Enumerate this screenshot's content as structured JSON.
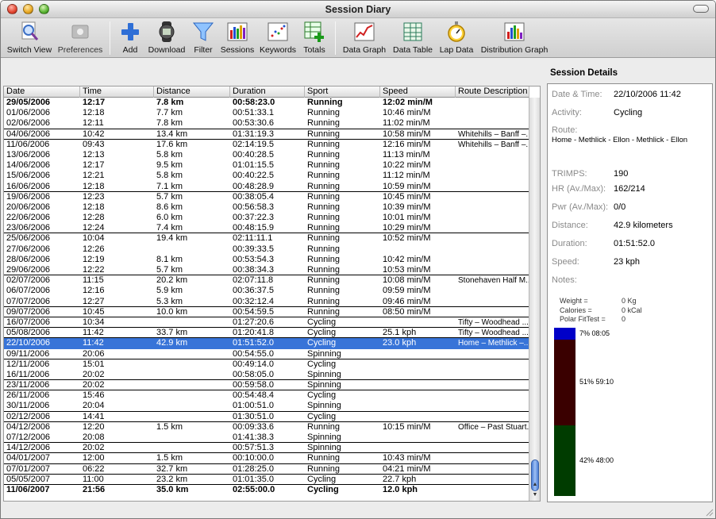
{
  "window": {
    "title": "Session Diary"
  },
  "toolbar": {
    "switch_view": "Switch View",
    "preferences": "Preferences",
    "add": "Add",
    "download": "Download",
    "filter": "Filter",
    "sessions": "Sessions",
    "keywords": "Keywords",
    "totals": "Totals",
    "data_graph": "Data Graph",
    "data_table": "Data Table",
    "lap_data": "Lap Data",
    "distribution_graph": "Distribution Graph"
  },
  "table": {
    "columns": [
      "Date",
      "Time",
      "Distance",
      "Duration",
      "Sport",
      "Speed",
      "Route Description"
    ],
    "rows": [
      {
        "date": "29/05/2006",
        "time": "12:17",
        "distance": "7.8 km",
        "duration": "00:58:23.0",
        "sport": "Running",
        "speed": "12:02 min/M",
        "route": "",
        "bold": true,
        "line": false
      },
      {
        "date": "01/06/2006",
        "time": "12:18",
        "distance": "7.7 km",
        "duration": "00:51:33.1",
        "sport": "Running",
        "speed": "10:46 min/M",
        "route": "",
        "line": false
      },
      {
        "date": "02/06/2006",
        "time": "12:11",
        "distance": "7.8 km",
        "duration": "00:53:30.6",
        "sport": "Running",
        "speed": "11:02 min/M",
        "route": "",
        "line": true
      },
      {
        "date": "04/06/2006",
        "time": "10:42",
        "distance": "13.4 km",
        "duration": "01:31:19.3",
        "sport": "Running",
        "speed": "10:58 min/M",
        "route": "Whitehills – Banff –...",
        "line": true
      },
      {
        "date": "11/06/2006",
        "time": "09:43",
        "distance": "17.6 km",
        "duration": "02:14:19.5",
        "sport": "Running",
        "speed": "12:16 min/M",
        "route": "Whitehills – Banff –...",
        "line": false
      },
      {
        "date": "13/06/2006",
        "time": "12:13",
        "distance": "5.8 km",
        "duration": "00:40:28.5",
        "sport": "Running",
        "speed": "11:13 min/M",
        "route": "",
        "line": false
      },
      {
        "date": "14/06/2006",
        "time": "12:17",
        "distance": "9.5 km",
        "duration": "01:01:15.5",
        "sport": "Running",
        "speed": "10:22 min/M",
        "route": "",
        "line": false
      },
      {
        "date": "15/06/2006",
        "time": "12:21",
        "distance": "5.8 km",
        "duration": "00:40:22.5",
        "sport": "Running",
        "speed": "11:12 min/M",
        "route": "",
        "line": false
      },
      {
        "date": "16/06/2006",
        "time": "12:18",
        "distance": "7.1 km",
        "duration": "00:48:28.9",
        "sport": "Running",
        "speed": "10:59 min/M",
        "route": "",
        "line": true
      },
      {
        "date": "19/06/2006",
        "time": "12:23",
        "distance": "5.7 km",
        "duration": "00:38:05.4",
        "sport": "Running",
        "speed": "10:45 min/M",
        "route": "",
        "line": false
      },
      {
        "date": "20/06/2006",
        "time": "12:18",
        "distance": "8.6 km",
        "duration": "00:56:58.3",
        "sport": "Running",
        "speed": "10:39 min/M",
        "route": "",
        "line": false
      },
      {
        "date": "22/06/2006",
        "time": "12:28",
        "distance": "6.0 km",
        "duration": "00:37:22.3",
        "sport": "Running",
        "speed": "10:01 min/M",
        "route": "",
        "line": false
      },
      {
        "date": "23/06/2006",
        "time": "12:24",
        "distance": "7.4 km",
        "duration": "00:48:15.9",
        "sport": "Running",
        "speed": "10:29 min/M",
        "route": "",
        "line": true
      },
      {
        "date": "25/06/2006",
        "time": "10:04",
        "distance": "19.4 km",
        "duration": "02:11:11.1",
        "sport": "Running",
        "speed": "10:52 min/M",
        "route": "",
        "line": false
      },
      {
        "date": "27/06/2006",
        "time": "12:26",
        "distance": "",
        "duration": "00:39:33.5",
        "sport": "Running",
        "speed": "",
        "route": "",
        "line": false
      },
      {
        "date": "28/06/2006",
        "time": "12:19",
        "distance": "8.1 km",
        "duration": "00:53:54.3",
        "sport": "Running",
        "speed": "10:42 min/M",
        "route": "",
        "line": false
      },
      {
        "date": "29/06/2006",
        "time": "12:22",
        "distance": "5.7 km",
        "duration": "00:38:34.3",
        "sport": "Running",
        "speed": "10:53 min/M",
        "route": "",
        "line": true
      },
      {
        "date": "02/07/2006",
        "time": "11:15",
        "distance": "20.2 km",
        "duration": "02:07:11.8",
        "sport": "Running",
        "speed": "10:08 min/M",
        "route": "Stonehaven Half M...",
        "line": false
      },
      {
        "date": "06/07/2006",
        "time": "12:16",
        "distance": "5.9 km",
        "duration": "00:36:37.5",
        "sport": "Running",
        "speed": "09:59 min/M",
        "route": "",
        "line": false
      },
      {
        "date": "07/07/2006",
        "time": "12:27",
        "distance": "5.3 km",
        "duration": "00:32:12.4",
        "sport": "Running",
        "speed": "09:46 min/M",
        "route": "",
        "line": true
      },
      {
        "date": "09/07/2006",
        "time": "10:45",
        "distance": "10.0 km",
        "duration": "00:54:59.5",
        "sport": "Running",
        "speed": "08:50 min/M",
        "route": "",
        "line": true
      },
      {
        "date": "16/07/2006",
        "time": "10:34",
        "distance": "",
        "duration": "01:27:20.6",
        "sport": "Cycling",
        "speed": "",
        "route": "Tifty – Woodhead ...",
        "line": true
      },
      {
        "date": "05/08/2006",
        "time": "11:42",
        "distance": "33.7 km",
        "duration": "01:20:41.8",
        "sport": "Cycling",
        "speed": "25.1 kph",
        "route": "Tifty – Woodhead ...",
        "line": true
      },
      {
        "date": "22/10/2006",
        "time": "11:42",
        "distance": "42.9 km",
        "duration": "01:51:52.0",
        "sport": "Cycling",
        "speed": "23.0 kph",
        "route": "Home – Methlick –...",
        "selected": true,
        "line": false
      },
      {
        "date": "09/11/2006",
        "time": "20:06",
        "distance": "",
        "duration": "00:54:55.0",
        "sport": "Spinning",
        "speed": "",
        "route": "",
        "line": true
      },
      {
        "date": "12/11/2006",
        "time": "15:01",
        "distance": "",
        "duration": "00:49:14.0",
        "sport": "Cycling",
        "speed": "",
        "route": "",
        "line": false
      },
      {
        "date": "16/11/2006",
        "time": "20:02",
        "distance": "",
        "duration": "00:58:05.0",
        "sport": "Spinning",
        "speed": "",
        "route": "",
        "line": true
      },
      {
        "date": "23/11/2006",
        "time": "20:02",
        "distance": "",
        "duration": "00:59:58.0",
        "sport": "Spinning",
        "speed": "",
        "route": "",
        "line": true
      },
      {
        "date": "26/11/2006",
        "time": "15:46",
        "distance": "",
        "duration": "00:54:48.4",
        "sport": "Cycling",
        "speed": "",
        "route": "",
        "line": false
      },
      {
        "date": "30/11/2006",
        "time": "20:04",
        "distance": "",
        "duration": "01:00:51.0",
        "sport": "Spinning",
        "speed": "",
        "route": "",
        "line": true
      },
      {
        "date": "02/12/2006",
        "time": "14:41",
        "distance": "",
        "duration": "01:30:51.0",
        "sport": "Cycling",
        "speed": "",
        "route": "",
        "line": true
      },
      {
        "date": "04/12/2006",
        "time": "12:20",
        "distance": "1.5 km",
        "duration": "00:09:33.6",
        "sport": "Running",
        "speed": "10:15 min/M",
        "route": "Office – Past Stuart...",
        "line": false
      },
      {
        "date": "07/12/2006",
        "time": "20:08",
        "distance": "",
        "duration": "01:41:38.3",
        "sport": "Spinning",
        "speed": "",
        "route": "",
        "line": true
      },
      {
        "date": "14/12/2006",
        "time": "20:02",
        "distance": "",
        "duration": "00:57:51.3",
        "sport": "Spinning",
        "speed": "",
        "route": "",
        "line": true
      },
      {
        "date": "04/01/2007",
        "time": "12:00",
        "distance": "1.5 km",
        "duration": "00:10:00.0",
        "sport": "Running",
        "speed": "10:43 min/M",
        "route": "",
        "line": true
      },
      {
        "date": "07/01/2007",
        "time": "06:22",
        "distance": "32.7 km",
        "duration": "01:28:25.0",
        "sport": "Running",
        "speed": "04:21 min/M",
        "route": "",
        "line": true
      },
      {
        "date": "05/05/2007",
        "time": "11:00",
        "distance": "23.2 km",
        "duration": "01:01:35.0",
        "sport": "Cycling",
        "speed": "22.7 kph",
        "route": "",
        "line": true
      },
      {
        "date": "11/06/2007",
        "time": "21:56",
        "distance": "35.0 km",
        "duration": "02:55:00.0",
        "sport": "Cycling",
        "speed": "12.0 kph",
        "route": "",
        "bold": true,
        "line": false
      }
    ]
  },
  "details": {
    "title": "Session Details",
    "date_label": "Date & Time:",
    "date_value": "22/10/2006 11:42",
    "activity_label": "Activity:",
    "activity_value": "Cycling",
    "route_label": "Route:",
    "route_value": "Home - Methlick - Ellon - Methlick - Ellon",
    "trimps_label": "TRIMPS:",
    "trimps_value": "190",
    "hr_label": "HR (Av./Max):",
    "hr_value": "162/214",
    "pwr_label": "Pwr (Av./Max):",
    "pwr_value": "0/0",
    "distance_label": "Distance:",
    "distance_value": "42.9 kilometers",
    "duration_label": "Duration:",
    "duration_value": "01:51:52.0",
    "speed_label": "Speed:",
    "speed_value": "23 kph",
    "notes_label": "Notes:",
    "weight_label": "Weight =",
    "weight_value": "0 Kg",
    "calories_label": "Calories =",
    "calories_value": "0 kCal",
    "fittest_label": "Polar FitTest =",
    "fittest_value": "0",
    "zones": [
      {
        "label": "7% 08:05",
        "fraction": 0.07,
        "color": "#0000c8"
      },
      {
        "label": "51% 59:10",
        "fraction": 0.51,
        "color": "#3a0000"
      },
      {
        "label": "42% 48:00",
        "fraction": 0.42,
        "color": "#003c00"
      }
    ]
  }
}
